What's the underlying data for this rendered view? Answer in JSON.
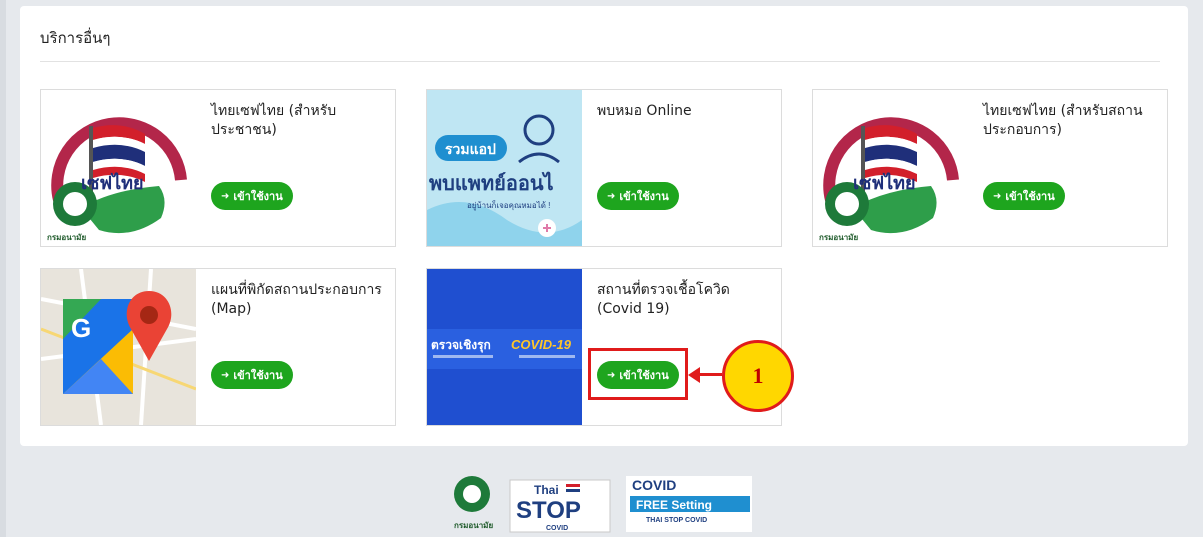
{
  "section": {
    "title": "บริการอื่นๆ"
  },
  "cards": [
    {
      "title": "ไทยเซฟไทย (สำหรับประชาชน)",
      "button": "เข้าใช้งาน",
      "thumb_text": "เซฟไทย",
      "thumb_caption": "กรมอนามัย"
    },
    {
      "title": "พบหมอ Online",
      "button": "เข้าใช้งาน",
      "thumb_line1": "รวมแอป",
      "thumb_line2": "พบแพทย์ออนไ",
      "thumb_line3": "อยู่บ้านก็เจอคุณหมอได้ !"
    },
    {
      "title": "ไทยเซฟไทย (สำหรับสถานประกอบการ)",
      "button": "เข้าใช้งาน",
      "thumb_text": "เซฟไทย",
      "thumb_caption": "กรมอนามัย"
    },
    {
      "title": "แผนที่พิกัดสถานประกอบการ (Map)",
      "button": "เข้าใช้งาน",
      "thumb_letter": "G"
    },
    {
      "title": "สถานที่ตรวจเชื้อโควิด (Covid 19)",
      "button": "เข้าใช้งาน",
      "thumb_line1": "ตรวจเชิงรุก",
      "thumb_line2": "COVID-19"
    }
  ],
  "annotation": {
    "step": "1"
  },
  "footer": {
    "logo1_caption": "กรมอนามัย",
    "logo2_top": "Thai",
    "logo2_main": "STOP",
    "logo2_sub": "COVID",
    "logo3_top": "COVID",
    "logo3_main": "FREE Setting",
    "logo3_sub": "THAI STOP COVID"
  },
  "colors": {
    "button_green": "#1ea51e",
    "highlight_red": "#e01b1b",
    "badge_yellow": "#ffd700",
    "page_bg": "#e6e9ed"
  }
}
